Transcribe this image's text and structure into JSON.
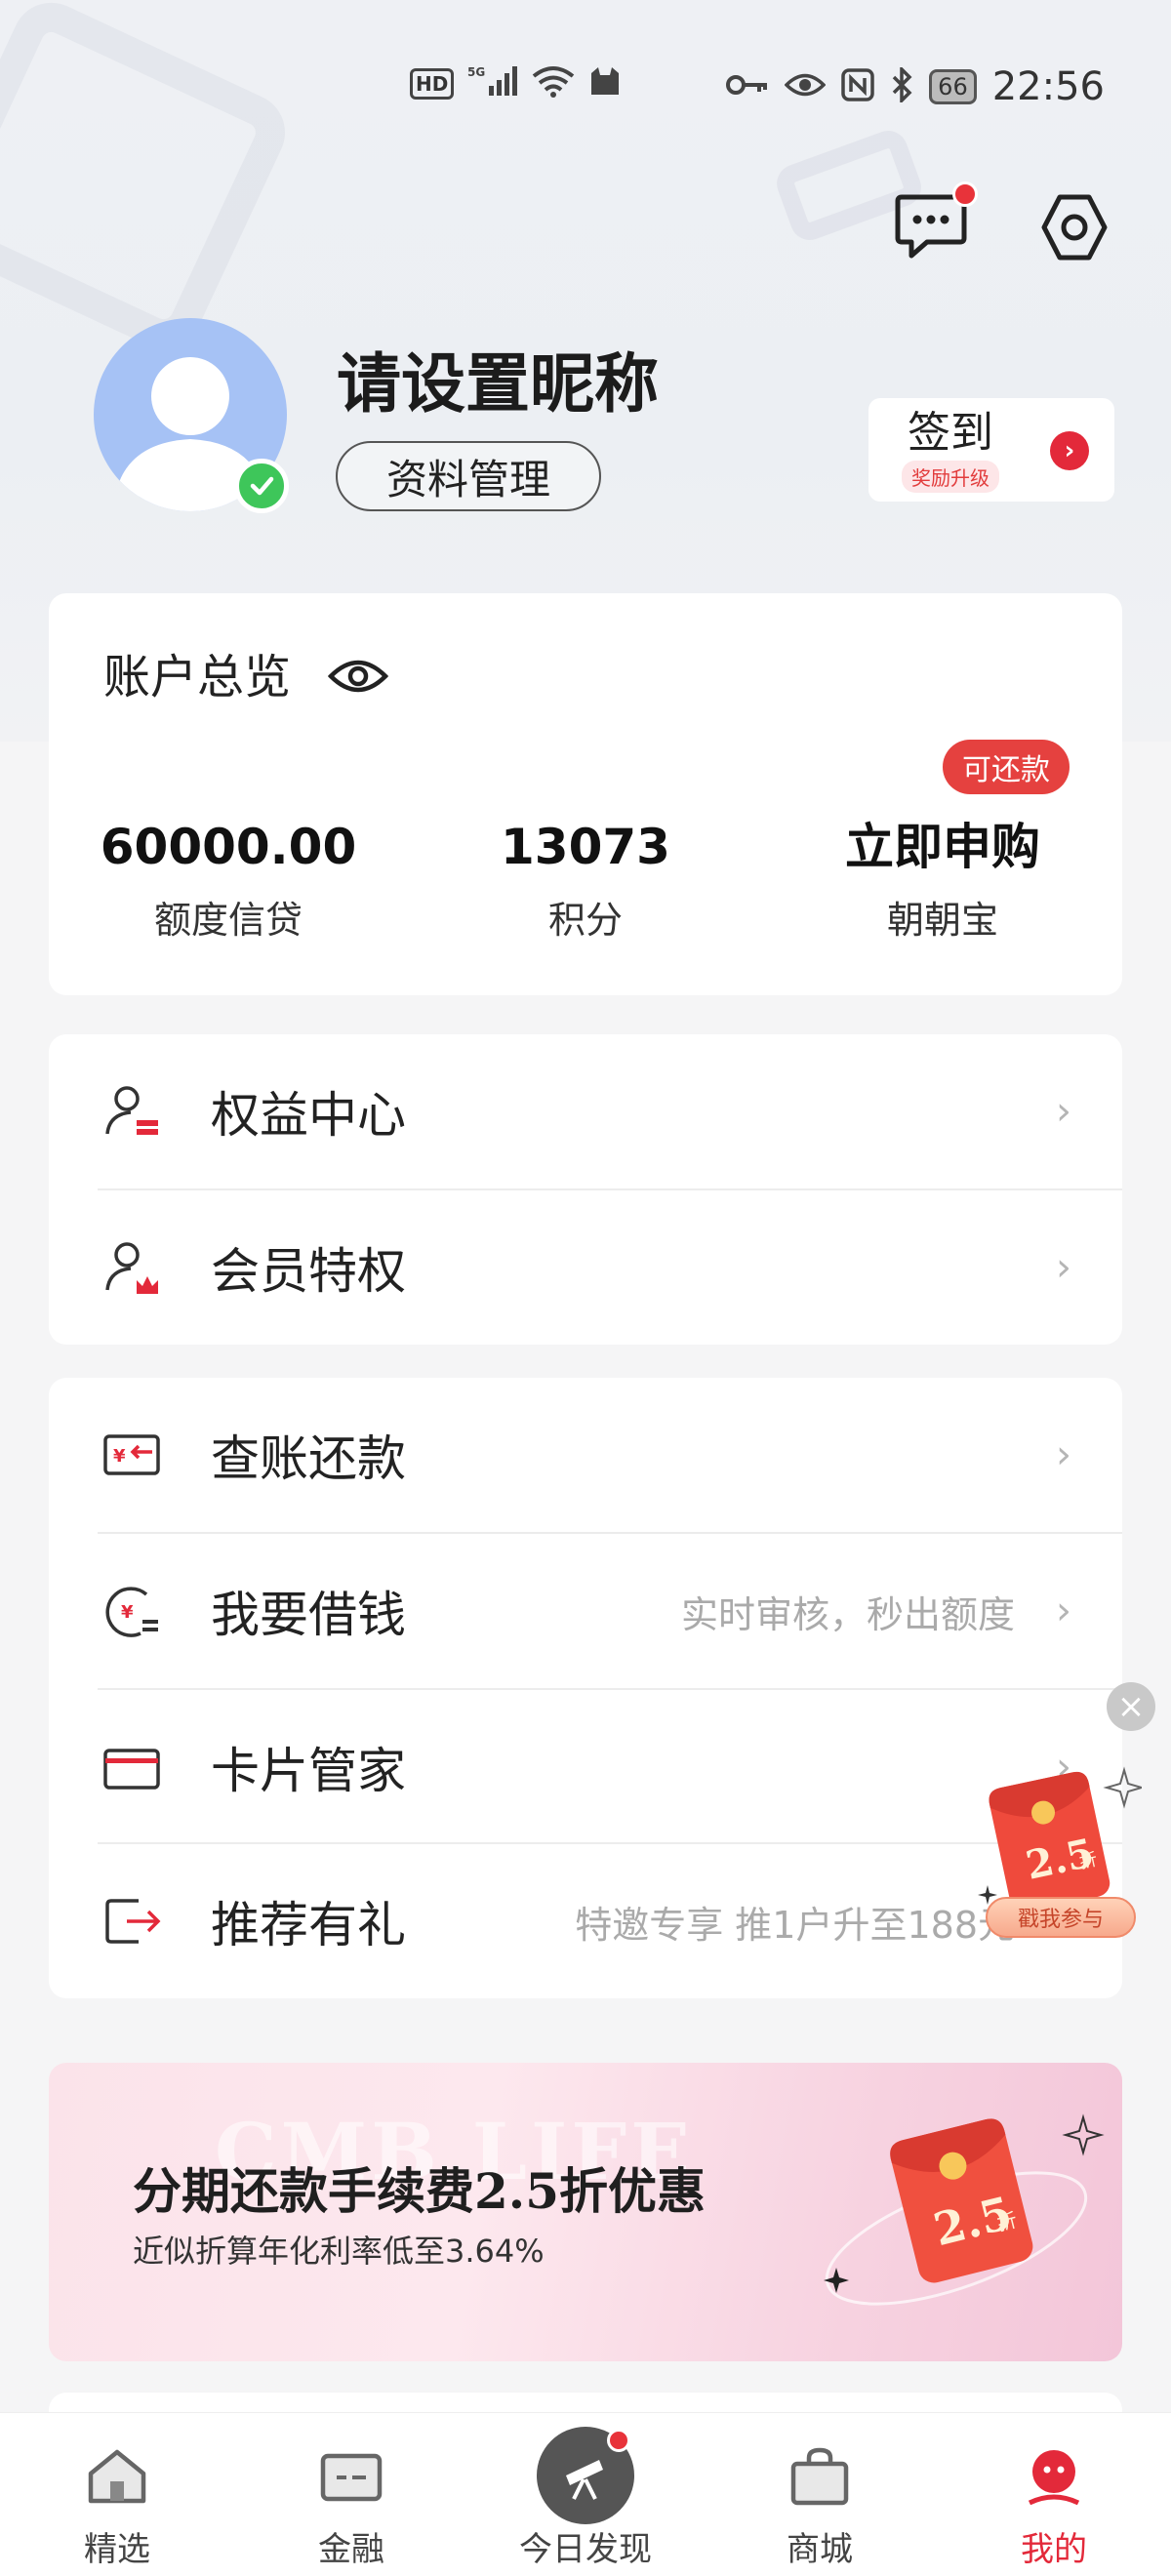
{
  "status_bar": {
    "left_icons": [
      "hd-icon",
      "5g-signal-icon",
      "wifi-icon",
      "cat-icon"
    ],
    "hd": "HD",
    "right_icons": [
      "key-icon",
      "eye-icon",
      "nfc-icon",
      "bluetooth-icon"
    ],
    "battery": "66",
    "time": "22:56"
  },
  "header": {
    "message_has_badge": true
  },
  "profile": {
    "nickname": "请设置昵称",
    "manage_label": "资料管理",
    "checkin_title": "签到",
    "checkin_sub": "奖励升级"
  },
  "account": {
    "title": "账户总览",
    "badge": "可还款",
    "stats": [
      {
        "value": "60000.00",
        "label": "额度信贷"
      },
      {
        "value": "13073",
        "label": "积分"
      },
      {
        "value": "立即申购",
        "label": "朝朝宝"
      }
    ]
  },
  "menu_a": [
    {
      "label": "权益中心",
      "sub": ""
    },
    {
      "label": "会员特权",
      "sub": ""
    }
  ],
  "menu_b": [
    {
      "label": "查账还款",
      "sub": ""
    },
    {
      "label": "我要借钱",
      "sub": "实时审核，秒出额度"
    },
    {
      "label": "卡片管家",
      "sub": ""
    },
    {
      "label": "推荐有礼",
      "sub": "特邀专享  推1户升至188元"
    }
  ],
  "floating": {
    "packet_text": "2.5",
    "packet_unit": "折",
    "button": "戳我参与"
  },
  "banner": {
    "watermark": "CMB LIFE",
    "title": "分期还款手续费2.5折优惠",
    "subtitle": "近似折算年化利率低至3.64%",
    "art_text": "2.5",
    "art_unit": "折"
  },
  "tabs": [
    {
      "label": "精选",
      "active": false
    },
    {
      "label": "金融",
      "active": false
    },
    {
      "label": "今日发现",
      "active": false
    },
    {
      "label": "商城",
      "active": false
    },
    {
      "label": "我的",
      "active": true
    }
  ],
  "colors": {
    "accent": "#e3293a",
    "avatar": "#a6c2f5",
    "verify": "#3ec65a"
  }
}
